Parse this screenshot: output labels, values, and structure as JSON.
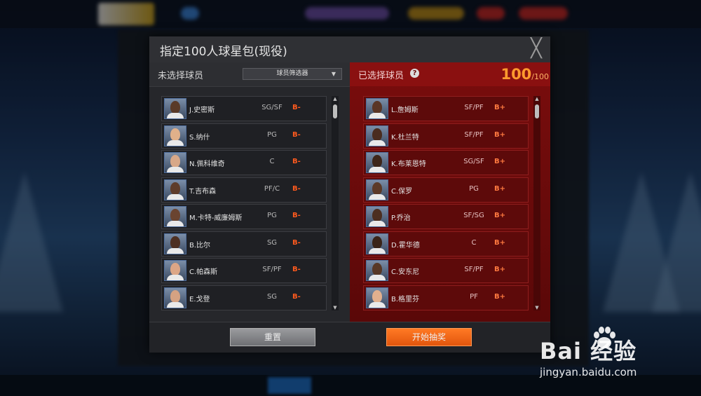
{
  "dialog": {
    "title": "指定100人球星包(现役)",
    "close_glyph": "╳"
  },
  "left_panel": {
    "label": "未选择球员",
    "filter_label": "球员筛选器",
    "players": [
      {
        "name": "J.史密斯",
        "pos": "SG/SF",
        "grade": "B-"
      },
      {
        "name": "S.纳什",
        "pos": "PG",
        "grade": "B-"
      },
      {
        "name": "N.佩科维奇",
        "pos": "C",
        "grade": "B-"
      },
      {
        "name": "T.吉布森",
        "pos": "PF/C",
        "grade": "B-"
      },
      {
        "name": "M.卡特-威廉姆斯",
        "pos": "PG",
        "grade": "B-"
      },
      {
        "name": "B.比尔",
        "pos": "SG",
        "grade": "B-"
      },
      {
        "name": "C.帕森斯",
        "pos": "SF/PF",
        "grade": "B-"
      },
      {
        "name": "E.戈登",
        "pos": "SG",
        "grade": "B-"
      }
    ]
  },
  "right_panel": {
    "label": "已选择球员",
    "help_glyph": "?",
    "count": "100",
    "count_max": "/100",
    "players": [
      {
        "name": "L.詹姆斯",
        "pos": "SF/PF",
        "grade": "B+"
      },
      {
        "name": "K.杜兰特",
        "pos": "SF/PF",
        "grade": "B+"
      },
      {
        "name": "K.布莱恩特",
        "pos": "SG/SF",
        "grade": "B+"
      },
      {
        "name": "C.保罗",
        "pos": "PG",
        "grade": "B+"
      },
      {
        "name": "P.乔治",
        "pos": "SF/SG",
        "grade": "B+"
      },
      {
        "name": "D.霍华德",
        "pos": "C",
        "grade": "B+"
      },
      {
        "name": "C.安东尼",
        "pos": "SF/PF",
        "grade": "B+"
      },
      {
        "name": "B.格里芬",
        "pos": "PF",
        "grade": "B+"
      }
    ]
  },
  "footer": {
    "reset_label": "重置",
    "start_label": "开始抽奖"
  },
  "watermark": {
    "main": "Bai  经验",
    "sub": "jingyan.baidu.com"
  },
  "colors": {
    "accent_orange": "#ff7a24",
    "grade_left": "#ff5a1e",
    "right_panel": "#7a0d0d"
  }
}
